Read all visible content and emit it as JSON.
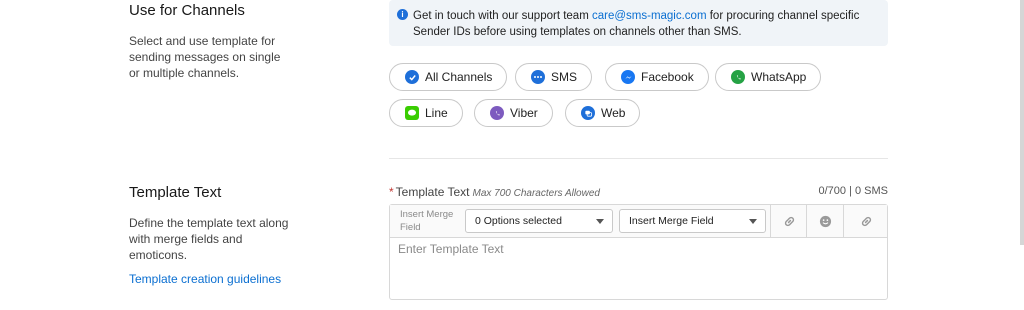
{
  "channels_section": {
    "title": "Use for Channels",
    "description": "Select and use template for sending messages on single or multiple channels."
  },
  "info_banner": {
    "text_before": "Get in touch with our support team ",
    "email": "care@sms-magic.com",
    "text_after": " for procuring channel specific Sender IDs before using templates on channels other than SMS."
  },
  "channels": [
    {
      "label": "All Channels",
      "icon": "check-circle-icon",
      "color": "#1e6fd9"
    },
    {
      "label": "SMS",
      "icon": "chat-bubble-icon",
      "color": "#1e6fd9"
    },
    {
      "label": "Facebook",
      "icon": "messenger-icon",
      "color": "#1877f2"
    },
    {
      "label": "WhatsApp",
      "icon": "whatsapp-icon",
      "color": "#25a244"
    },
    {
      "label": "Line",
      "icon": "line-icon",
      "color": "#3acd01"
    },
    {
      "label": "Viber",
      "icon": "viber-icon",
      "color": "#7d5bbf"
    },
    {
      "label": "Web",
      "icon": "web-chat-icon",
      "color": "#1e6fd9"
    }
  ],
  "template_section": {
    "title": "Template Text",
    "description": "Define the template text along with merge fields and emoticons.",
    "guidelines_link": "Template creation guidelines"
  },
  "template_field": {
    "required_mark": "*",
    "label": "Template Text",
    "hint": "Max 700 Characters Allowed",
    "counter": "0/700 | 0 SMS",
    "toolbar_label": "Insert Merge Field",
    "options_select": "0 Options selected",
    "merge_select": "Insert Merge Field",
    "placeholder": "Enter Template Text"
  }
}
